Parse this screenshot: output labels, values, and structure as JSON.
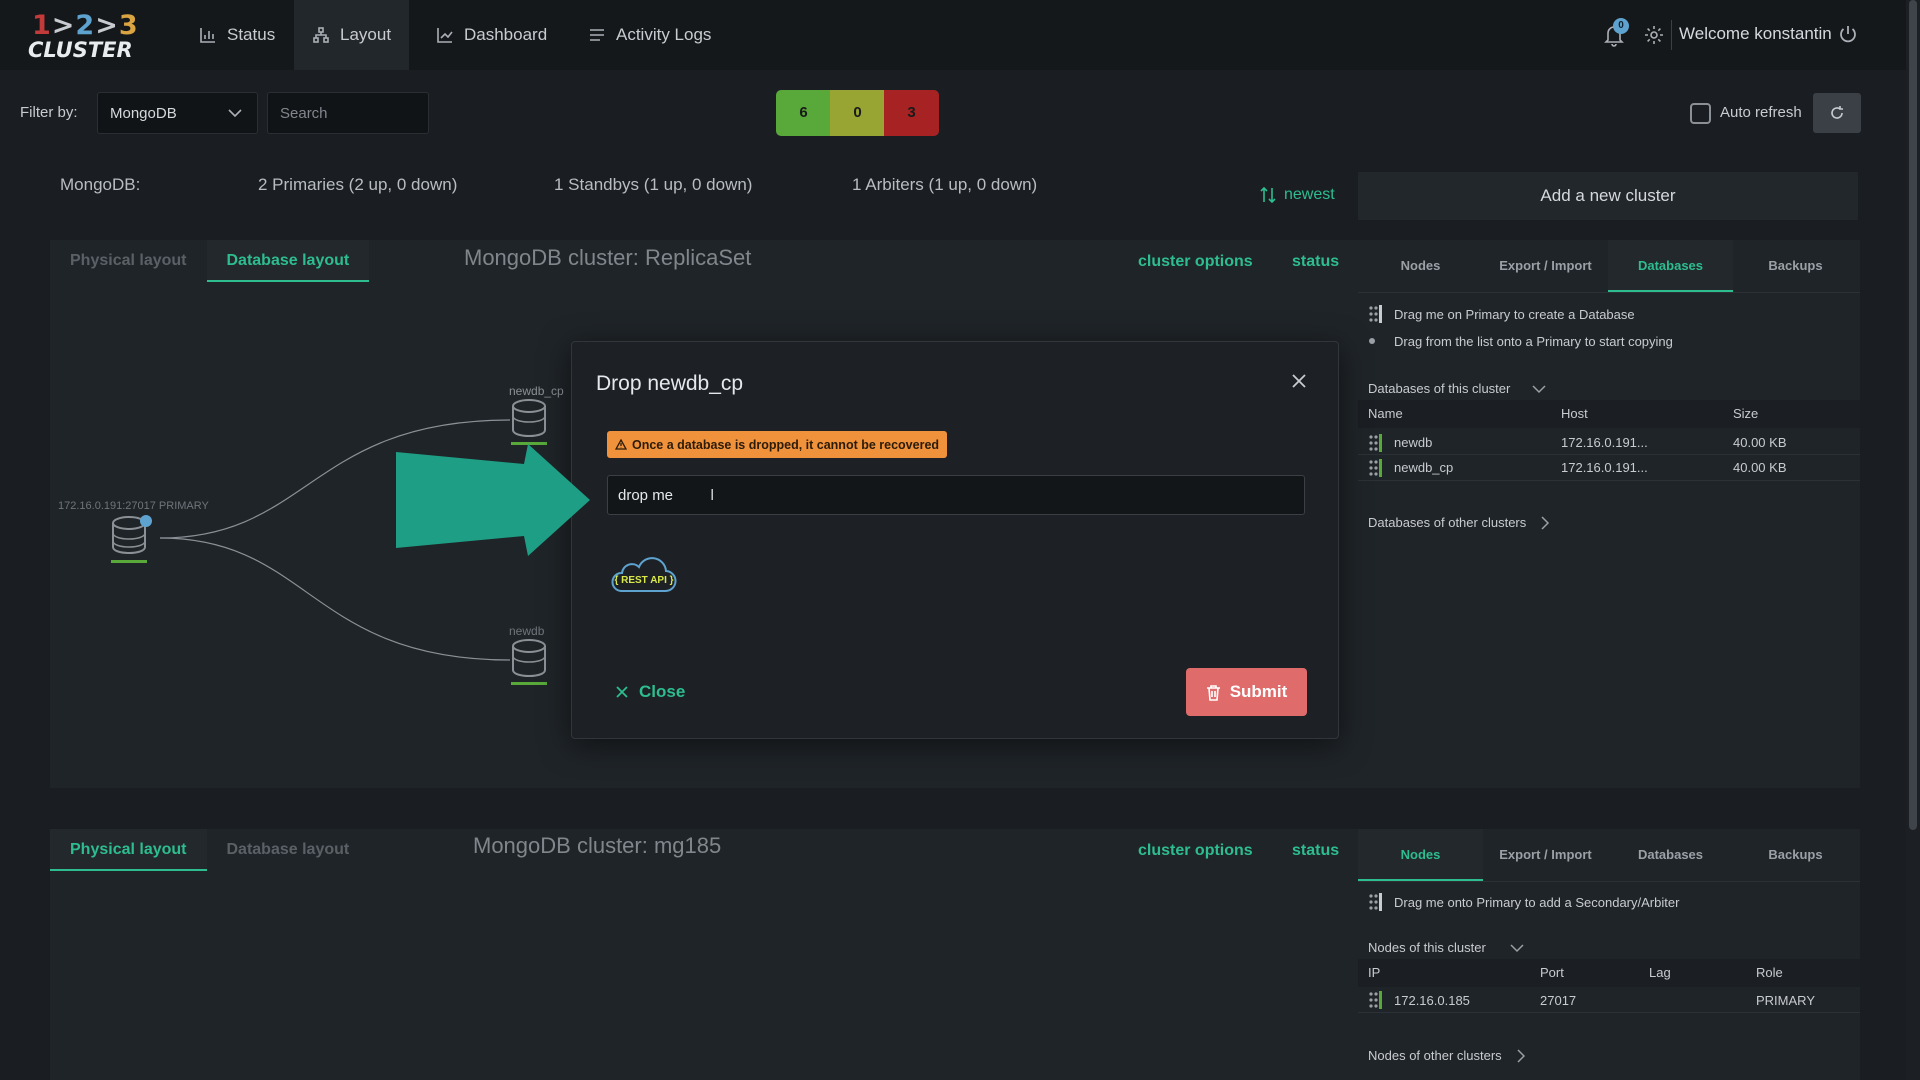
{
  "app": {
    "logo_nums": "1>2>3",
    "logo_word": "CLUSTER"
  },
  "nav": {
    "items": [
      {
        "label": "Status",
        "icon": "bar-chart-icon"
      },
      {
        "label": "Layout",
        "icon": "sitemap-icon"
      },
      {
        "label": "Dashboard",
        "icon": "line-chart-icon"
      },
      {
        "label": "Activity Logs",
        "icon": "list-icon"
      }
    ],
    "active": "Layout",
    "notification_count": "0",
    "welcome": "Welcome konstantin"
  },
  "filter": {
    "label": "Filter by:",
    "selected": "MongoDB",
    "search_placeholder": "Search",
    "counts": {
      "green": "6",
      "yellow": "0",
      "red": "3"
    },
    "auto_refresh_label": "Auto refresh",
    "auto_refresh_checked": false
  },
  "summary": {
    "type": "MongoDB:",
    "primaries": "2 Primaries (2 up, 0 down)",
    "standbys": "1 Standbys (1 up, 0 down)",
    "arbiters": "1 Arbiters (1 up, 0 down)",
    "sort": "newest",
    "add_cluster": "Add a new cluster"
  },
  "cluster1": {
    "tabs": [
      "Physical layout",
      "Database layout"
    ],
    "active_tab": "Database layout",
    "title": "MongoDB cluster: ReplicaSet",
    "options": "cluster options",
    "status": "status",
    "primary_node_label": "172.16.0.191:27017 PRIMARY",
    "db_nodes": [
      "newdb_cp",
      "newdb"
    ],
    "side": {
      "tabs": [
        "Nodes",
        "Export / Import",
        "Databases",
        "Backups"
      ],
      "active_tab": "Databases",
      "hint1": "Drag me on Primary to create a Database",
      "hint2": "Drag from the list onto a Primary to start copying",
      "section": "Databases of this cluster",
      "columns": [
        "Name",
        "Host",
        "Size"
      ],
      "rows": [
        {
          "name": "newdb",
          "host": "172.16.0.191...",
          "size": "40.00 KB"
        },
        {
          "name": "newdb_cp",
          "host": "172.16.0.191...",
          "size": "40.00 KB"
        }
      ],
      "other": "Databases of other clusters"
    }
  },
  "cluster2": {
    "tabs": [
      "Physical layout",
      "Database layout"
    ],
    "active_tab": "Physical layout",
    "title": "MongoDB cluster: mg185",
    "options": "cluster options",
    "status": "status",
    "side": {
      "tabs": [
        "Nodes",
        "Export / Import",
        "Databases",
        "Backups"
      ],
      "active_tab": "Nodes",
      "hint1": "Drag me onto Primary to add a Secondary/Arbiter",
      "section": "Nodes of this cluster",
      "columns": [
        "IP",
        "Port",
        "Lag",
        "Role"
      ],
      "rows": [
        {
          "ip": "172.16.0.185",
          "port": "27017",
          "lag": "",
          "role": "PRIMARY"
        }
      ],
      "other": "Nodes of other clusters"
    }
  },
  "modal": {
    "title": "Drop newdb_cp",
    "warning": "Once a database is dropped, it cannot be recovered",
    "input_value": "drop me",
    "rest_api": "{ REST API }",
    "close": "Close",
    "submit": "Submit"
  },
  "colors": {
    "accent": "#2dbd8e",
    "danger": "#e06b6b",
    "warning": "#f0923b",
    "arrow": "#1e9e84"
  }
}
